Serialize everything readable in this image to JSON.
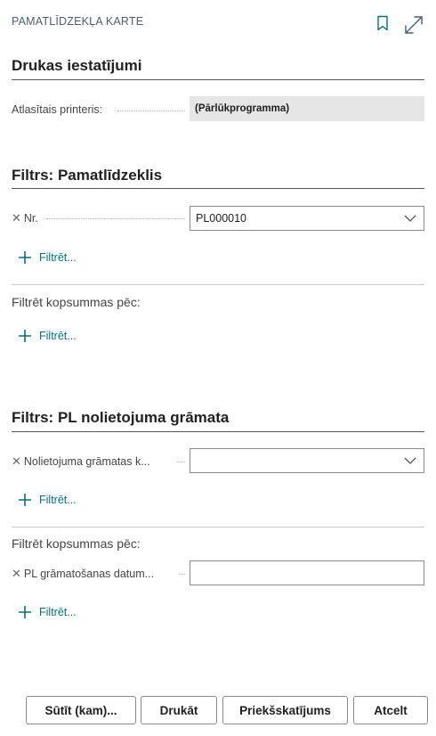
{
  "header": {
    "title": "PAMATLĪDZEKĻA KARTE"
  },
  "print_settings": {
    "heading": "Drukas iestatījumi",
    "printer_label": "Atlasītais printeris:",
    "printer_value": "(Pārlūkprogramma)"
  },
  "filter_asset": {
    "heading": "Filtrs: Pamatlīdzeklis",
    "field_label": "Nr.",
    "field_value": "PL000010",
    "add_filter": "Filtrēt...",
    "totals_heading": "Filtrēt kopsummas pēc:",
    "totals_add_filter": "Filtrēt..."
  },
  "filter_book": {
    "heading": "Filtrs: PL nolietojuma grāmata",
    "field_label": "Nolietojuma grāmatas k...",
    "field_value": "",
    "add_filter": "Filtrēt...",
    "totals_heading": "Filtrēt kopsummas pēc:",
    "totals_field_label": "PL grāmatošanas datum...",
    "totals_field_value": "",
    "totals_add_filter": "Filtrēt..."
  },
  "footer": {
    "send_to": "Sūtīt (kam)...",
    "print": "Drukāt",
    "preview": "Priekšskatījums",
    "cancel": "Atcelt"
  },
  "colors": {
    "accent": "#00727d",
    "title": "#505c6d",
    "readonly_bg": "#e6e6e6"
  },
  "icons": [
    "bookmark-icon",
    "expand-icon",
    "close-icon",
    "chevron-down-icon",
    "plus-icon"
  ]
}
